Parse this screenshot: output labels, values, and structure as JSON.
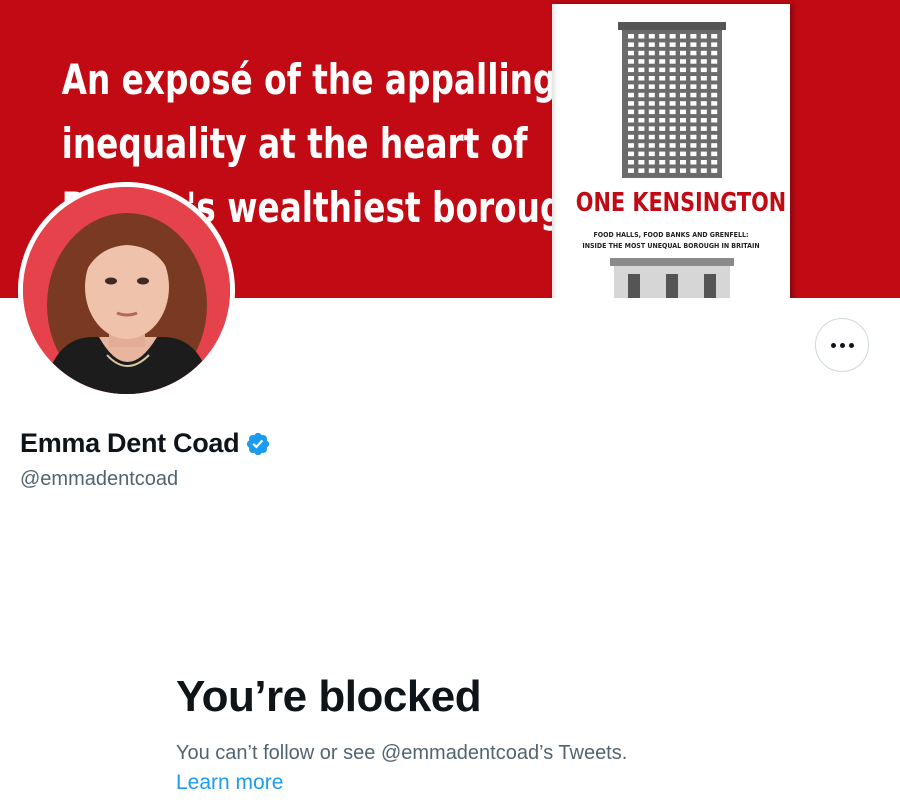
{
  "banner": {
    "lines": [
      "An exposé of the appalling",
      "inequality at the heart of",
      "Britain's wealthiest borough"
    ],
    "background_color": "#c10a14",
    "book": {
      "title": "ONE KENSINGTON",
      "subtitle_lines": [
        "FOOD HALLS, FOOD BANKS AND GRENFELL:",
        "INSIDE THE MOST UNEQUAL BOROUGH IN BRITAIN"
      ]
    }
  },
  "profile": {
    "display_name": "Emma Dent Coad",
    "handle": "@emmadentcoad",
    "verified": true,
    "verified_color": "#1d9bf0",
    "more_button_icon": "more-horizontal-icon"
  },
  "blocked": {
    "title": "You’re blocked",
    "description": "You can’t follow or see @emmadentcoad’s Tweets.",
    "link_label": "Learn more",
    "link_color": "#1d9bf0"
  }
}
